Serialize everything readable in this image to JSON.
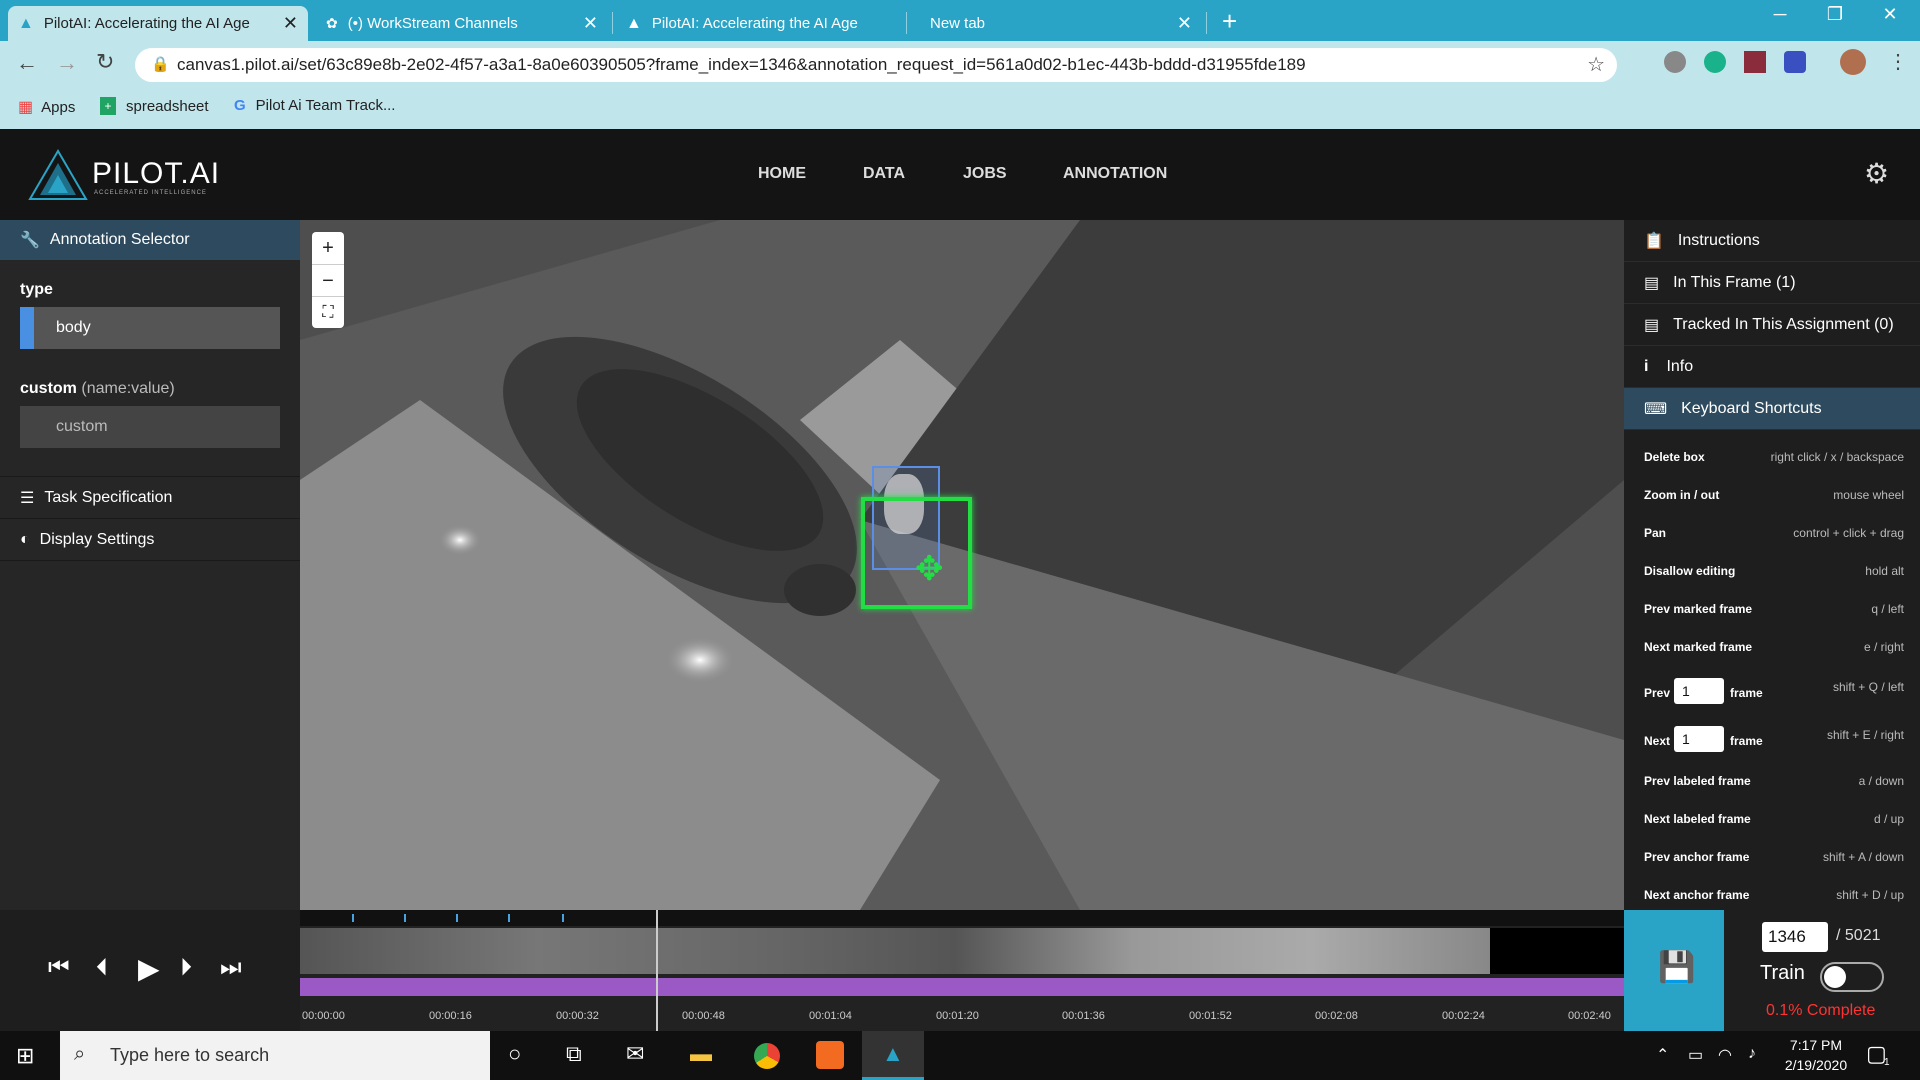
{
  "browser": {
    "tabs": [
      {
        "title": "PilotAI: Accelerating the AI Age",
        "active": true
      },
      {
        "title": "(•) WorkStream Channels",
        "active": false
      },
      {
        "title": "PilotAI: Accelerating the AI Age",
        "active": false
      },
      {
        "title": "New tab",
        "active": false
      }
    ],
    "url": "canvas1.pilot.ai/set/63c89e8b-2e02-4f57-a3a1-8a0e60390505?frame_index=1346&annotation_request_id=561a0d02-b1ec-443b-bddd-d31955fde189",
    "bookmarks": [
      "Apps",
      "spreadsheet",
      "Pilot Ai Team Track..."
    ]
  },
  "app": {
    "logo_text": "PILOT.AI",
    "logo_sub": "ACCELERATED INTELLIGENCE",
    "nav": [
      "HOME",
      "DATA",
      "JOBS",
      "ANNOTATION"
    ]
  },
  "left_panel": {
    "annotation_selector": "Annotation Selector",
    "type_label": "type",
    "type_value": "body",
    "custom_label": "custom",
    "custom_hint": "(name:value)",
    "custom_placeholder": "custom",
    "task_spec": "Task Specification",
    "display_settings": "Display Settings"
  },
  "right_panel": {
    "instructions": "Instructions",
    "in_this_frame": "In This Frame (1)",
    "tracked": "Tracked In This Assignment (0)",
    "info": "Info",
    "keyboard_shortcuts": "Keyboard Shortcuts",
    "shortcuts": [
      {
        "name": "Delete box",
        "keys": "right click / x / backspace"
      },
      {
        "name": "Zoom in / out",
        "keys": "mouse wheel"
      },
      {
        "name": "Pan",
        "keys": "control + click + drag"
      },
      {
        "name": "Disallow editing",
        "keys": "hold alt"
      },
      {
        "name": "Prev marked frame",
        "keys": "q / left"
      },
      {
        "name": "Next marked frame",
        "keys": "e / right"
      },
      {
        "name": "Prev labeled frame",
        "keys": "a / down"
      },
      {
        "name": "Next labeled frame",
        "keys": "d / up"
      },
      {
        "name": "Prev anchor frame",
        "keys": "shift + A / down"
      },
      {
        "name": "Next anchor frame",
        "keys": "shift + D / up"
      }
    ],
    "prev_n": {
      "prefix": "Prev",
      "value": "1",
      "suffix": "frame",
      "keys": "shift + Q / left"
    },
    "next_n": {
      "prefix": "Next",
      "value": "1",
      "suffix": "frame",
      "keys": "shift + E / right"
    }
  },
  "timeline": {
    "ticks": [
      "00:00:00",
      "00:00:16",
      "00:00:32",
      "00:00:48",
      "00:01:04",
      "00:01:20",
      "00:01:36",
      "00:01:52",
      "00:02:08",
      "00:02:24",
      "00:02:40"
    ]
  },
  "frame": {
    "current": "1346",
    "total": "/ 5021",
    "train_label": "Train",
    "complete": "0.1% Complete"
  },
  "taskbar": {
    "search_placeholder": "Type here to search",
    "time": "7:17 PM",
    "date": "2/19/2020",
    "notification_count": "1"
  },
  "colors": {
    "tab_bar": "#2aa4c6",
    "accent_blue": "#2aa4c6",
    "selected_header": "#2d4a5e",
    "timeline_purple": "#9b59c6",
    "complete_red": "#ff3333",
    "bbox_green": "#22dd44"
  }
}
